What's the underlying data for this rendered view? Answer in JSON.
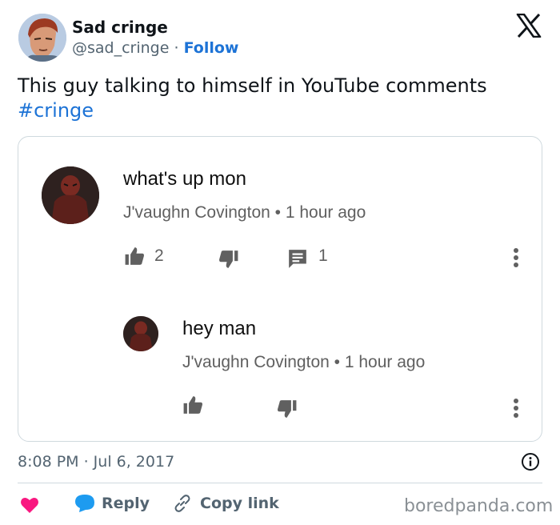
{
  "tweet": {
    "author_name": "Sad cringe",
    "handle": "@sad_cringe",
    "separator": "·",
    "follow_label": "Follow",
    "text": "This guy talking to himself in YouTube comments",
    "hashtag": "#cringe",
    "timestamp": "8:08 PM · Jul 6, 2017"
  },
  "youtube_comments": [
    {
      "text": "what's up mon",
      "author": "J'vaughn Covington",
      "dot": "•",
      "time": "1 hour ago",
      "likes": "2",
      "replies": "1"
    },
    {
      "text": "hey man",
      "author": "J'vaughn Covington",
      "dot": "•",
      "time": "1 hour ago"
    }
  ],
  "actions": {
    "reply_label": "Reply",
    "copy_link_label": "Copy link"
  },
  "watermark": "boredpanda.com",
  "colors": {
    "like_heart": "#f91880",
    "reply_bubble": "#1d9bf0",
    "link_blue": "#1d73d6"
  }
}
